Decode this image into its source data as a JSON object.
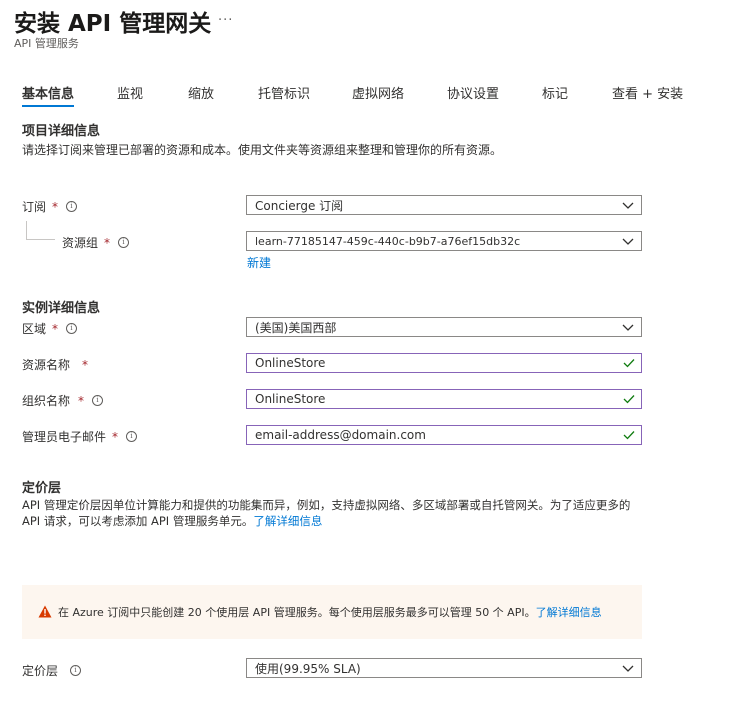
{
  "header": {
    "title": "安装 API 管理网关",
    "more": "...",
    "subtitle": "API 管理服务"
  },
  "tabs": [
    {
      "label": "基本信息",
      "active": true
    },
    {
      "label": "监视"
    },
    {
      "label": "缩放"
    },
    {
      "label": "托管标识"
    },
    {
      "label": "虚拟网络"
    },
    {
      "label": "协议设置"
    },
    {
      "label": "标记"
    },
    {
      "label": "查看 + 安装"
    }
  ],
  "project": {
    "title": "项目详细信息",
    "description": "请选择订阅来管理已部署的资源和成本。使用文件夹等资源组来整理和管理你的所有资源。",
    "subscription": {
      "label": "订阅",
      "value": "Concierge 订阅"
    },
    "resource_group": {
      "label": "资源组",
      "value": "learn-77185147-459c-440c-b9b7-a76ef15db32c",
      "new_link": "新建"
    }
  },
  "instance": {
    "title": "实例详细信息",
    "region": {
      "label": "区域",
      "value": "(美国)美国西部"
    },
    "resource_name": {
      "label": "资源名称",
      "value": "OnlineStore"
    },
    "org_name": {
      "label": "组织名称",
      "value": "OnlineStore"
    },
    "admin_email": {
      "label": "管理员电子邮件",
      "value": "email-address@domain.com"
    }
  },
  "pricing": {
    "title": "定价层",
    "description_line1": "API 管理定价层因单位计算能力和提供的功能集而异，例如，支持虚拟网络、多区域部署或自托管网关。为了适应更多的",
    "description_line2": "API 请求，可以考虑添加 API 管理服务单元。",
    "learn_more": "了解详细信息",
    "warning_text": "在 Azure 订阅中只能创建 20 个使用层 API 管理服务。每个使用层服务最多可以管理 50 个 API。",
    "warning_link": "了解详细信息",
    "tier": {
      "label": "定价层",
      "value": "使用(99.95% SLA)"
    }
  },
  "icons": {
    "info": "info-icon",
    "warning": "warning-icon",
    "chevron": "chevron-down-icon",
    "check": "checkmark-icon"
  },
  "colors": {
    "accent": "#0078d4",
    "required": "#a4262c",
    "valid_border": "#8764b8",
    "valid_check": "#107c10",
    "warning": "#d83b01",
    "warning_bg": "#fdf6ef"
  }
}
